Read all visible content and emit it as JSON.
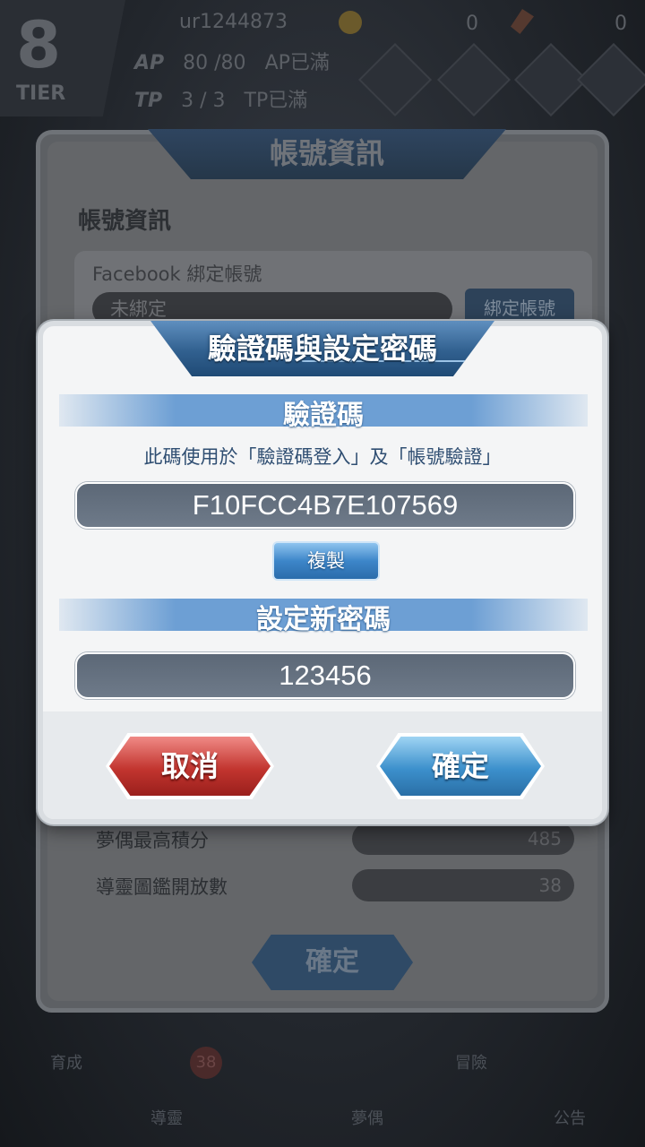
{
  "topbar": {
    "tier_number": "8",
    "tier_label": "TIER",
    "user_id": "ur1244873",
    "currency1": "0",
    "currency2": "0",
    "ap_key": "AP",
    "ap_value": "80 /80",
    "ap_status": "AP已滿",
    "tp_key": "TP",
    "tp_value": "3 / 3",
    "tp_status": "TP已滿"
  },
  "bottom_nav": {
    "items": [
      "育成",
      "導靈",
      "夢偶",
      "冒險",
      "公告"
    ],
    "badge_count": "38"
  },
  "account_dialog": {
    "title": "帳號資訊",
    "section": "帳號資訊",
    "facebook_label": "Facebook 綁定帳號",
    "facebook_status": "未綁定",
    "bind_button": "綁定帳號",
    "stats": [
      {
        "label": "夢偶最高積分",
        "value": "485"
      },
      {
        "label": "導靈圖鑑開放數",
        "value": "38"
      }
    ],
    "confirm_label": "確定"
  },
  "modal": {
    "title": "驗證碼與設定密碼",
    "code_section_title": "驗證碼",
    "code_description": "此碼使用於「驗證碼登入」及「帳號驗證」",
    "code_value": "F10FCC4B7E107569",
    "copy_label": "複製",
    "password_section_title": "設定新密碼",
    "password_value": "123456",
    "cancel_label": "取消",
    "ok_label": "確定"
  },
  "colors": {
    "banner_blue": "#31608f",
    "section_band_blue": "#6d9fd4",
    "cancel_red": "#c2352f",
    "ok_blue": "#3c90cc"
  }
}
